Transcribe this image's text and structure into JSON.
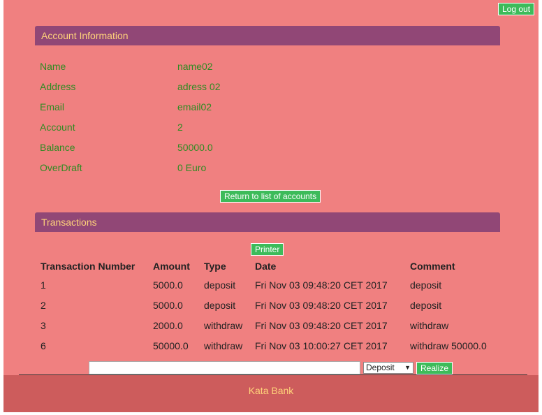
{
  "header": {
    "logout_label": "Log out"
  },
  "account_panel": {
    "title": "Account Information",
    "rows": [
      {
        "label": "Name",
        "value": "name02"
      },
      {
        "label": "Address",
        "value": "adress 02"
      },
      {
        "label": "Email",
        "value": "email02"
      },
      {
        "label": "Account",
        "value": "2"
      },
      {
        "label": "Balance",
        "value": "50000.0"
      },
      {
        "label": "OverDraft",
        "value": "0 Euro"
      }
    ],
    "return_label": "Return to list of accounts"
  },
  "transactions_panel": {
    "title": "Transactions",
    "printer_label": "Printer",
    "columns": [
      "Transaction Number",
      "Amount",
      "Type",
      "Date",
      "Comment"
    ],
    "rows": [
      [
        "1",
        "5000.0",
        "deposit",
        "Fri Nov 03 09:48:20 CET 2017",
        "deposit"
      ],
      [
        "2",
        "5000.0",
        "deposit",
        "Fri Nov 03 09:48:20 CET 2017",
        "deposit"
      ],
      [
        "3",
        "2000.0",
        "withdraw",
        "Fri Nov 03 09:48:20 CET 2017",
        "withdraw"
      ],
      [
        "6",
        "50000.0",
        "withdraw",
        "Fri Nov 03 10:00:27 CET 2017",
        "withdraw 50000.0"
      ]
    ],
    "form": {
      "amount_value": "",
      "type_selected": "Deposit",
      "realize_label": "Realize"
    }
  },
  "footer": {
    "text": "Kata Bank"
  },
  "colors": {
    "page_bg": "#f08080",
    "panel_header": "#914776",
    "panel_title": "#ffd27a",
    "label_green": "#2e8b22",
    "button_green": "#3dbb5a",
    "footer_bg": "#cd5c5c"
  }
}
